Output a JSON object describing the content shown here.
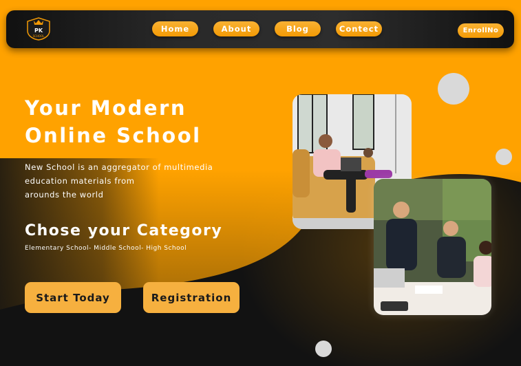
{
  "brand": {
    "logo_text": "PK",
    "logo_subtext": "SCHOOL"
  },
  "nav": {
    "items": [
      "Home",
      "About",
      "Blog",
      "Contect"
    ],
    "enroll_label": "EnrollNo"
  },
  "hero": {
    "title_line1": "Your Modern",
    "title_line2": "Online School",
    "desc_line1": "New School is an aggregator of multimedia",
    "desc_line2": "education materials from",
    "desc_line3": "arounds the world"
  },
  "category": {
    "title": "Chose your Category",
    "subtitle": "Elementary School- Middle School- High School"
  },
  "cta": {
    "start_label": "Start Today",
    "register_label": "Registration"
  },
  "colors": {
    "accent": "#FFA200",
    "dark": "#121212",
    "button": "#F6B03F",
    "white": "#FFFFFF"
  },
  "images": [
    "photo-people-on-couch-with-laptop",
    "photo-business-meeting-at-table"
  ]
}
